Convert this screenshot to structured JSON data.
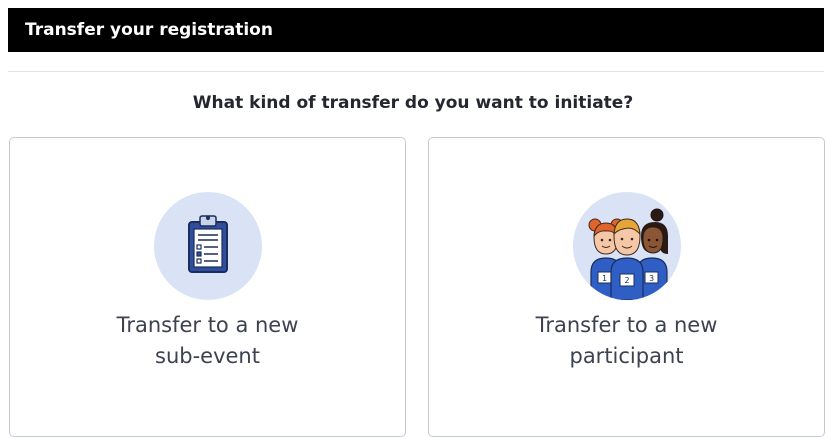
{
  "header": {
    "title": "Transfer your registration",
    "background": "#000000"
  },
  "question": "What kind of transfer do you want to initiate?",
  "options": [
    {
      "icon": "clipboard-icon",
      "label_line1": "Transfer to a new",
      "label_line2": "sub-event"
    },
    {
      "icon": "participants-icon",
      "label_line1": "Transfer to a new",
      "label_line2": "participant"
    }
  ],
  "colors": {
    "icon_circle": "#d9e3f5",
    "card_border": "#c7c9cf",
    "label_text": "#3d4150"
  }
}
